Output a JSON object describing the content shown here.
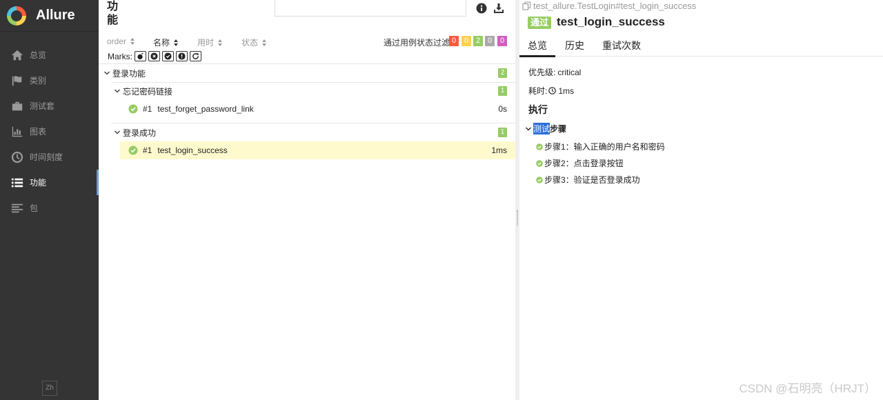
{
  "sidebar": {
    "brand": "Allure",
    "items": [
      {
        "label": "总览",
        "icon": "home-icon"
      },
      {
        "label": "类别",
        "icon": "flag-icon"
      },
      {
        "label": "测试套",
        "icon": "briefcase-icon"
      },
      {
        "label": "图表",
        "icon": "bar-chart-icon"
      },
      {
        "label": "时间刻度",
        "icon": "clock-icon"
      },
      {
        "label": "功能",
        "icon": "list-icon",
        "active": true
      },
      {
        "label": "包",
        "icon": "align-left-icon"
      }
    ],
    "language": "Zh"
  },
  "list": {
    "title": "功能",
    "search_placeholder": "",
    "sort": {
      "order": "order",
      "name": "名称",
      "duration": "用时",
      "status": "状态"
    },
    "filter_label": "通过用例状态过滤:",
    "status_counts": [
      {
        "value": "0",
        "color": "#fd5a3e"
      },
      {
        "value": "0",
        "color": "#ffd050"
      },
      {
        "value": "2",
        "color": "#97cc64"
      },
      {
        "value": "0",
        "color": "#aaaaaa"
      },
      {
        "value": "0",
        "color": "#d35ebe"
      }
    ],
    "marks_label": "Marks:",
    "tree": {
      "feature": {
        "label": "登录功能",
        "count": "2"
      },
      "groups": [
        {
          "label": "忘记密码链接",
          "count": "1",
          "cases": [
            {
              "num": "#1",
              "name": "test_forget_password_link",
              "duration": "0s"
            }
          ]
        },
        {
          "label": "登录成功",
          "count": "1",
          "cases": [
            {
              "num": "#1",
              "name": "test_login_success",
              "duration": "1ms"
            }
          ]
        }
      ]
    }
  },
  "detail": {
    "breadcrumb": "test_allure.TestLogin#test_login_success",
    "status": "通过",
    "title": "test_login_success",
    "tabs": [
      "总览",
      "历史",
      "重试次数"
    ],
    "severity_label": "优先级:",
    "severity_value": "critical",
    "duration_label": "耗时:",
    "duration_value": "1ms",
    "execution_heading": "执行",
    "steps_heading_hl": "测试",
    "steps_heading_rest": "步骤",
    "steps": [
      "步骤1：输入正确的用户名和密码",
      "步骤2：点击登录按钮",
      "步骤3：验证是否登录成功"
    ]
  },
  "watermark": "CSDN @石明亮（HRJT）",
  "colors": {
    "passed": "#97cc64",
    "sidebar": "#343434"
  }
}
